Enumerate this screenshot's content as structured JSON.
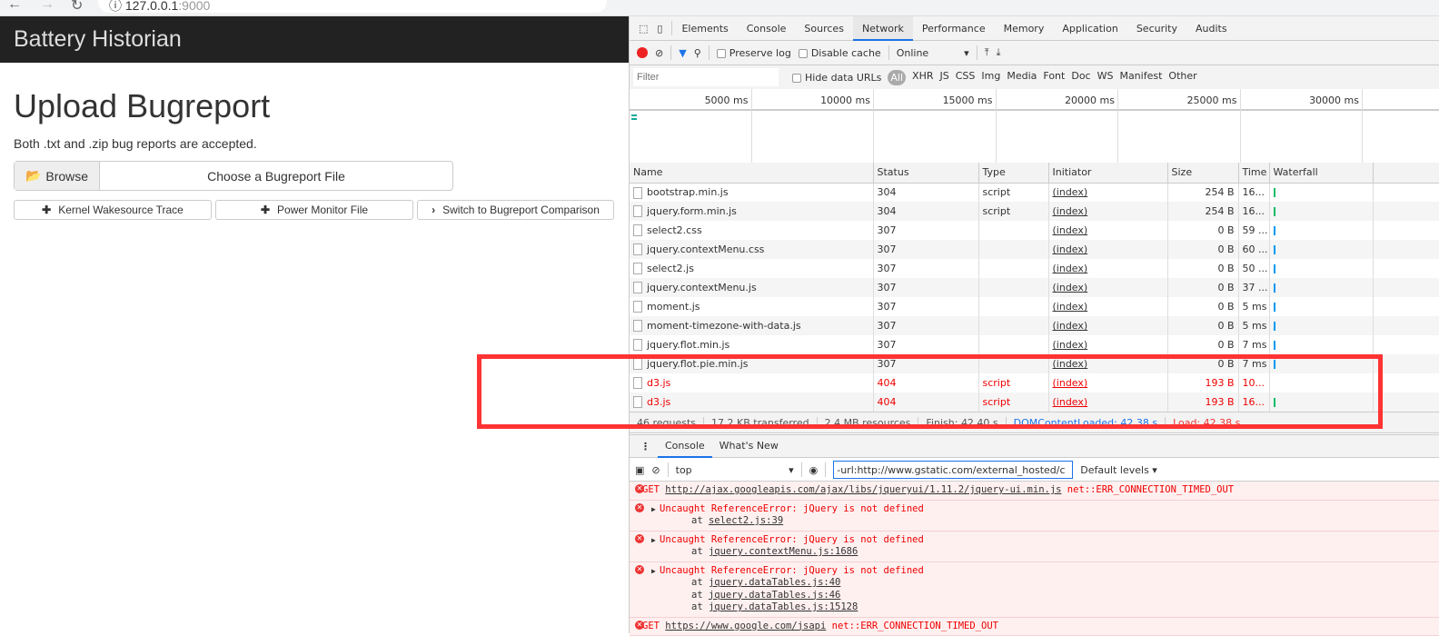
{
  "browser": {
    "url_host": "127.0.0.1",
    "url_port": ":9000"
  },
  "page": {
    "brand": "Battery Historian",
    "title": "Upload Bugreport",
    "subtitle": "Both .txt and .zip bug reports are accepted.",
    "browse_label": "Browse",
    "choose_label": "Choose a Bugreport File",
    "buttons": [
      "Kernel Wakesource Trace",
      "Power Monitor File",
      "Switch to Bugreport Comparison"
    ]
  },
  "devtools": {
    "tabs": [
      "Elements",
      "Console",
      "Sources",
      "Network",
      "Performance",
      "Memory",
      "Application",
      "Security",
      "Audits"
    ],
    "active_tab": "Network",
    "toolbar": {
      "preserve_log": "Preserve log",
      "disable_cache": "Disable cache",
      "throttle": "Online"
    },
    "filter": {
      "placeholder": "Filter",
      "hide_data_urls": "Hide data URLs",
      "types": [
        "All",
        "XHR",
        "JS",
        "CSS",
        "Img",
        "Media",
        "Font",
        "Doc",
        "WS",
        "Manifest",
        "Other"
      ]
    },
    "ticks": [
      "5000 ms",
      "10000 ms",
      "15000 ms",
      "20000 ms",
      "25000 ms",
      "30000 ms"
    ],
    "columns": [
      "Name",
      "Status",
      "Type",
      "Initiator",
      "Size",
      "Time",
      "Waterfall"
    ],
    "rows": [
      {
        "name": "bootstrap.min.js",
        "status": "304",
        "type": "script",
        "initiator": "(index)",
        "size": "254 B",
        "time": "16...",
        "error": false
      },
      {
        "name": "jquery.form.min.js",
        "status": "304",
        "type": "script",
        "initiator": "(index)",
        "size": "254 B",
        "time": "16...",
        "error": false
      },
      {
        "name": "select2.css",
        "status": "307",
        "type": "",
        "initiator": "(index)",
        "size": "0 B",
        "time": "59 ...",
        "error": false
      },
      {
        "name": "jquery.contextMenu.css",
        "status": "307",
        "type": "",
        "initiator": "(index)",
        "size": "0 B",
        "time": "60 ...",
        "error": false
      },
      {
        "name": "select2.js",
        "status": "307",
        "type": "",
        "initiator": "(index)",
        "size": "0 B",
        "time": "50 ...",
        "error": false
      },
      {
        "name": "jquery.contextMenu.js",
        "status": "307",
        "type": "",
        "initiator": "(index)",
        "size": "0 B",
        "time": "37 ...",
        "error": false
      },
      {
        "name": "moment.js",
        "status": "307",
        "type": "",
        "initiator": "(index)",
        "size": "0 B",
        "time": "5 ms",
        "error": false
      },
      {
        "name": "moment-timezone-with-data.js",
        "status": "307",
        "type": "",
        "initiator": "(index)",
        "size": "0 B",
        "time": "5 ms",
        "error": false
      },
      {
        "name": "jquery.flot.min.js",
        "status": "307",
        "type": "",
        "initiator": "(index)",
        "size": "0 B",
        "time": "7 ms",
        "error": false
      },
      {
        "name": "jquery.flot.pie.min.js",
        "status": "307",
        "type": "",
        "initiator": "(index)",
        "size": "0 B",
        "time": "7 ms",
        "error": false
      },
      {
        "name": "d3.js",
        "status": "404",
        "type": "script",
        "initiator": "(index)",
        "size": "193 B",
        "time": "10...",
        "error": true
      },
      {
        "name": "d3.js",
        "status": "404",
        "type": "script",
        "initiator": "(index)",
        "size": "193 B",
        "time": "16...",
        "error": true
      }
    ],
    "summary": [
      "46 requests",
      "17.2 KB transferred",
      "2.4 MB resources",
      "Finish: 42.40 s",
      "DOMContentLoaded: 42.38 s",
      "Load: 42.38 s"
    ],
    "drawer_tabs": [
      "Console",
      "What's New"
    ],
    "console_context": "top",
    "console_filter": "-url:http://www.gstatic.com/external_hosted/c",
    "levels": "Default levels",
    "messages": [
      {
        "head": "GET ",
        "link": "http://ajax.googleapis.com/ajax/libs/jqueryui/1.11.2/jquery-ui.min.js",
        "tail": " net::ERR_CONNECTION_TIMED_OUT",
        "stack": []
      },
      {
        "head": "Uncaught ReferenceError: jQuery is not defined",
        "stack": [
          "select2.js:39"
        ]
      },
      {
        "head": "Uncaught ReferenceError: jQuery is not defined",
        "stack": [
          "jquery.contextMenu.js:1686"
        ]
      },
      {
        "head": "Uncaught ReferenceError: jQuery is not defined",
        "stack": [
          "jquery.dataTables.js:40",
          "jquery.dataTables.js:46",
          "jquery.dataTables.js:15128"
        ]
      },
      {
        "head": "GET ",
        "link": "https://www.google.com/jsapi",
        "tail": " net::ERR_CONNECTION_TIMED_OUT",
        "stack": []
      }
    ]
  },
  "colors": {
    "error": "#ee0000",
    "accent": "#1a73e8",
    "annotation": "#ff3333",
    "navbar": "#222222"
  }
}
